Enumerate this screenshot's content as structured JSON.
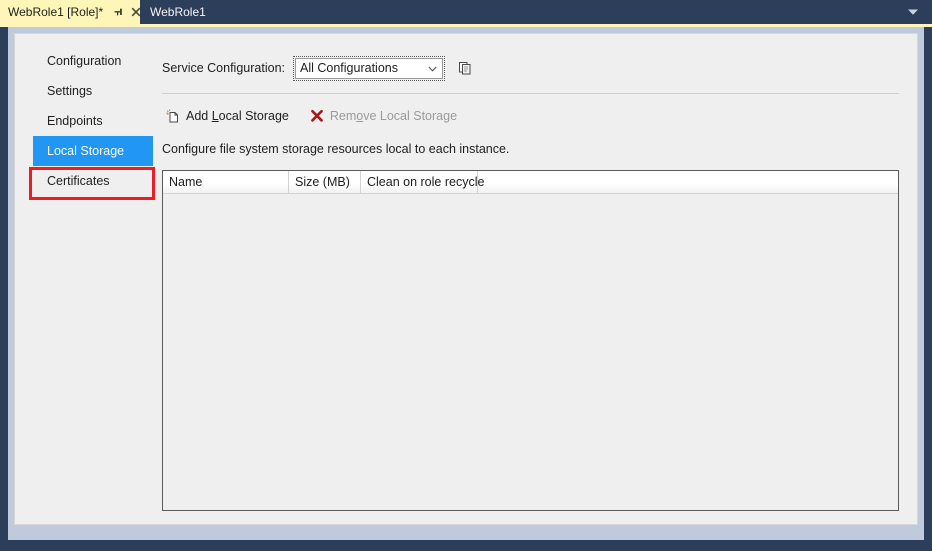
{
  "window": {
    "tabs": [
      {
        "title": "WebRole1 [Role]*",
        "active": true,
        "pin_icon": "pin-icon",
        "close_icon": "close-icon"
      },
      {
        "title": "WebRole1",
        "active": false
      }
    ],
    "overflow_icon": "chevron-down-icon"
  },
  "nav": {
    "items": [
      {
        "label": "Configuration",
        "selected": false
      },
      {
        "label": "Settings",
        "selected": false
      },
      {
        "label": "Endpoints",
        "selected": false
      },
      {
        "label": "Local Storage",
        "selected": true
      },
      {
        "label": "Certificates",
        "selected": false
      }
    ]
  },
  "service_configuration": {
    "label_before": "Service Confi",
    "label_accel": "g",
    "label_after": "uration:",
    "label_full": "Service Configuration:",
    "selected_value": "All Configurations",
    "options": [
      "All Configurations"
    ],
    "copy_icon": "copy-pages-icon",
    "dropdown_icon": "chevron-down-icon"
  },
  "toolbar": {
    "add": {
      "text_before": "Add ",
      "accel": "L",
      "text_after": "ocal Storage",
      "full": "Add Local Storage",
      "icon": "new-document-icon",
      "enabled": true
    },
    "remove": {
      "text_before": "Rem",
      "accel": "o",
      "text_after": "ve Local Storage",
      "full": "Remove Local Storage",
      "icon": "red-x-icon",
      "enabled": false
    }
  },
  "description": "Configure file system storage resources local to each instance.",
  "grid": {
    "columns": [
      {
        "header": "Name",
        "width": 126
      },
      {
        "header": "Size (MB)",
        "width": 72
      },
      {
        "header": "Clean on role recycle",
        "width": 117
      },
      {
        "header": "",
        "width": 0
      }
    ],
    "rows": []
  },
  "colors": {
    "accent_selection": "#2196f3",
    "annotation": "#ee1c25",
    "active_tab": "#fdf6b8",
    "chrome_dark": "#2d3e5b",
    "remove_icon": "#a21b1b"
  }
}
